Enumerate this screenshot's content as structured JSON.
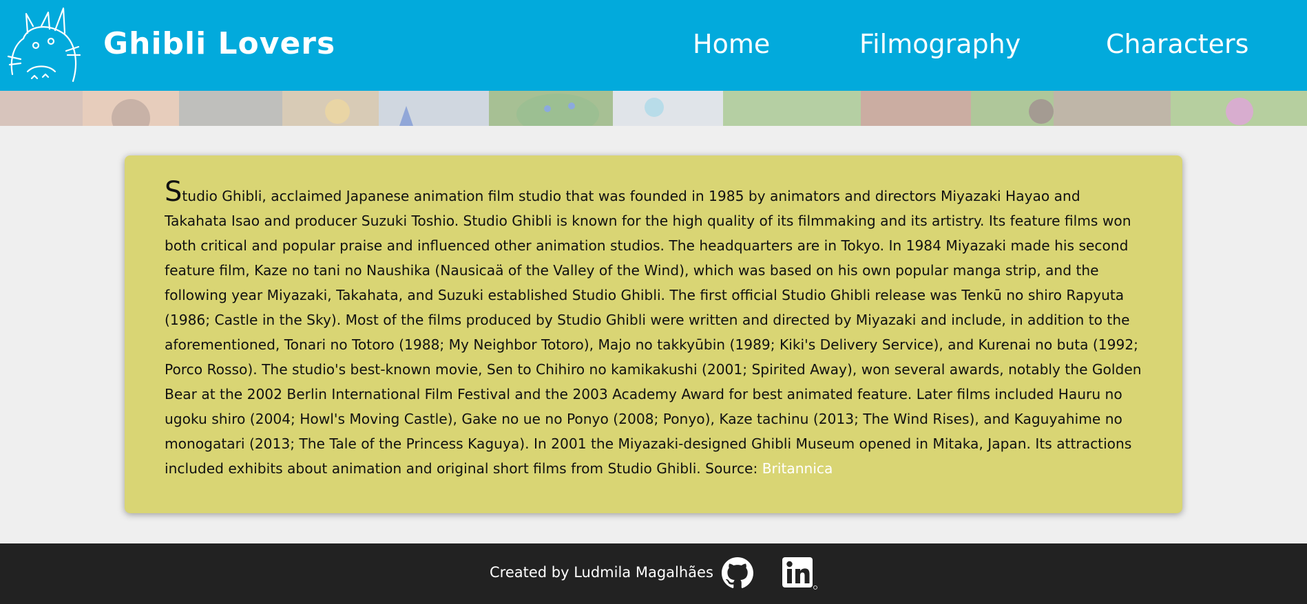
{
  "header": {
    "brand": "Ghibli Lovers",
    "logo_icon": "totoro-icon",
    "nav": [
      {
        "label": "Home"
      },
      {
        "label": "Filmography"
      },
      {
        "label": "Characters"
      }
    ],
    "background_color": "#02aadc"
  },
  "about": {
    "drop_cap": "S",
    "text": "tudio Ghibli, acclaimed Japanese animation film studio that was founded in 1985 by animators and directors Miyazaki Hayao and Takahata Isao and producer Suzuki Toshio. Studio Ghibli is known for the high quality of its filmmaking and its artistry. Its feature films won both critical and popular praise and influenced other animation studios. The headquarters are in Tokyo. In 1984 Miyazaki made his second feature film, Kaze no tani no Naushika (Nausicaä of the Valley of the Wind), which was based on his own popular manga strip, and the following year Miyazaki, Takahata, and Suzuki established Studio Ghibli. The first official Studio Ghibli release was Tenkū no shiro Rapyuta (1986; Castle in the Sky). Most of the films produced by Studio Ghibli were written and directed by Miyazaki and include, in addition to the aforementioned, Tonari no Totoro (1988; My Neighbor Totoro), Majo no takkyūbin (1989; Kiki's Delivery Service), and Kurenai no buta (1992; Porco Rosso). The studio's best-known movie, Sen to Chihiro no kamikakushi (2001; Spirited Away), won several awards, notably the Golden Bear at the 2002 Berlin International Film Festival and the 2003 Academy Award for best animated feature. Later films included Hauru no ugoku shiro (2004; Howl's Moving Castle), Gake no ue no Ponyo (2008; Ponyo), Kaze tachinu (2013; The Wind Rises), and Kaguyahime no monogatari (2013; The Tale of the Princess Kaguya). In 2001 the Miyazaki-designed Ghibli Museum opened in Mitaka, Japan. Its attractions included exhibits about animation and original short films from Studio Ghibli. Source: ",
    "source_link": "Britannica",
    "card_color": "#d9d574"
  },
  "footer": {
    "credit": "Created by Ludmila Magalhães",
    "icons": [
      "github-icon",
      "linkedin-icon"
    ],
    "background_color": "#222222"
  }
}
